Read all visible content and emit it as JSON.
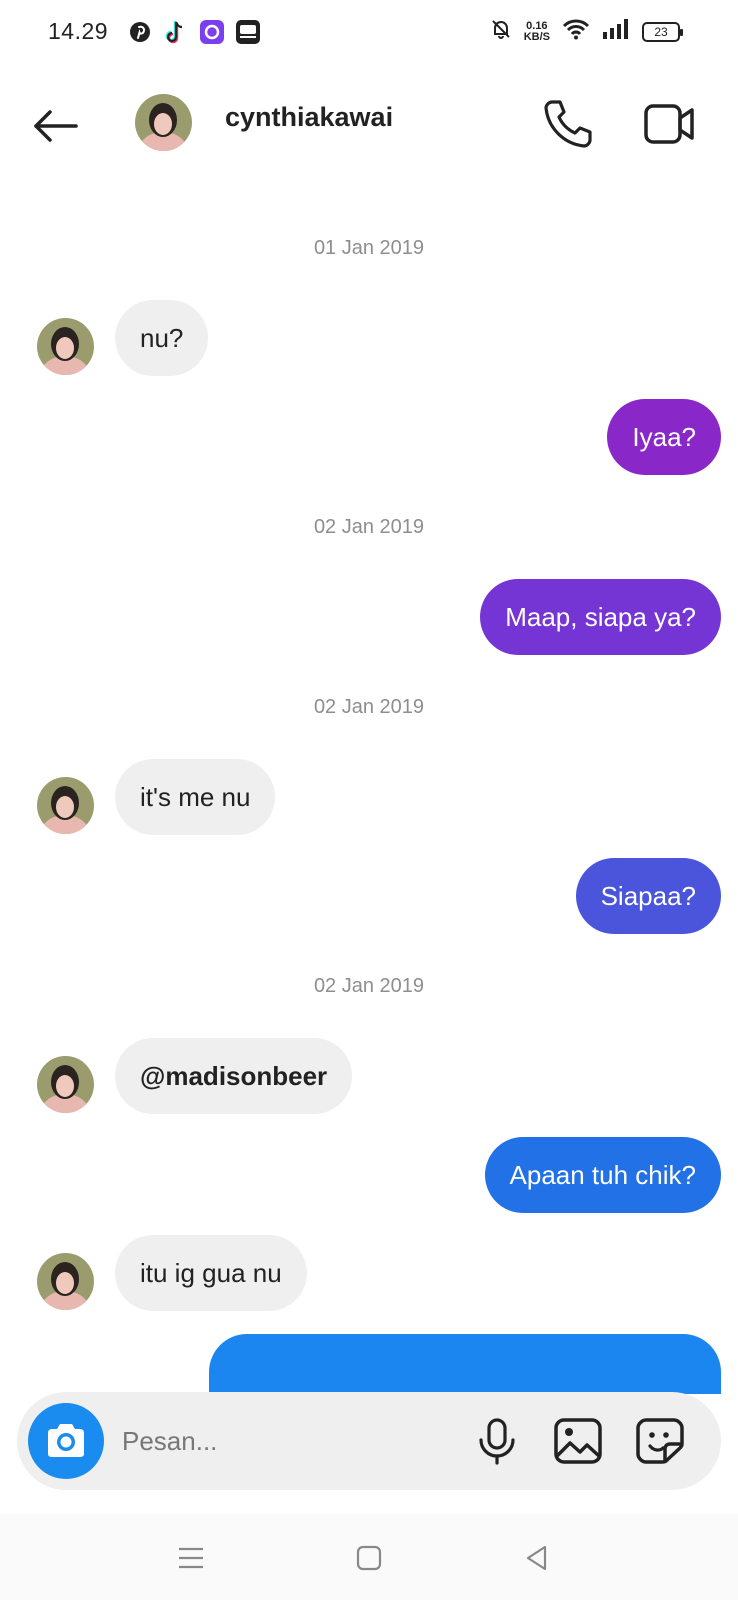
{
  "status_bar": {
    "time": "14.29",
    "app_icons": [
      "pinterest-icon",
      "tiktok-icon",
      "app-circle-icon",
      "kwik-icon"
    ],
    "net_speed_value": "0.16",
    "net_speed_unit": "KB/S",
    "battery": "23"
  },
  "header": {
    "username": "cynthiakawai",
    "icons": [
      "back-arrow-icon",
      "phone-icon",
      "video-camera-icon"
    ]
  },
  "messages": [
    {
      "type": "date",
      "text": "01 Jan 2019"
    },
    {
      "type": "in",
      "text": "nu?"
    },
    {
      "type": "out",
      "text": "Iyaa?",
      "color": "#8a27c9"
    },
    {
      "type": "date",
      "text": "02 Jan 2019"
    },
    {
      "type": "out",
      "text": "Maap, siapa ya?",
      "color": "#7534d4"
    },
    {
      "type": "date",
      "text": "02 Jan 2019"
    },
    {
      "type": "in",
      "text": "it's me nu"
    },
    {
      "type": "out",
      "text": "Siapaa?",
      "color": "#4a55db"
    },
    {
      "type": "date",
      "text": "02 Jan 2019"
    },
    {
      "type": "in",
      "text": "@madisonbeer",
      "bold": true
    },
    {
      "type": "out",
      "text": "Apaan tuh chik?",
      "color": "#2271e6"
    },
    {
      "type": "in",
      "text": "itu ig gua nu"
    },
    {
      "type": "out",
      "text": "",
      "color": "#1c86f0",
      "partial": true
    }
  ],
  "composer": {
    "placeholder": "Pesan...",
    "value": "",
    "icons": [
      "camera-icon",
      "microphone-icon",
      "gallery-icon",
      "sticker-icon"
    ]
  },
  "nav_bar": {
    "icons": [
      "menu-icon",
      "home-icon",
      "back-icon"
    ]
  },
  "colors": {
    "incoming_bubble": "#efefef",
    "camera_button": "#1a8cf0",
    "date_text": "#8e8e8e"
  }
}
